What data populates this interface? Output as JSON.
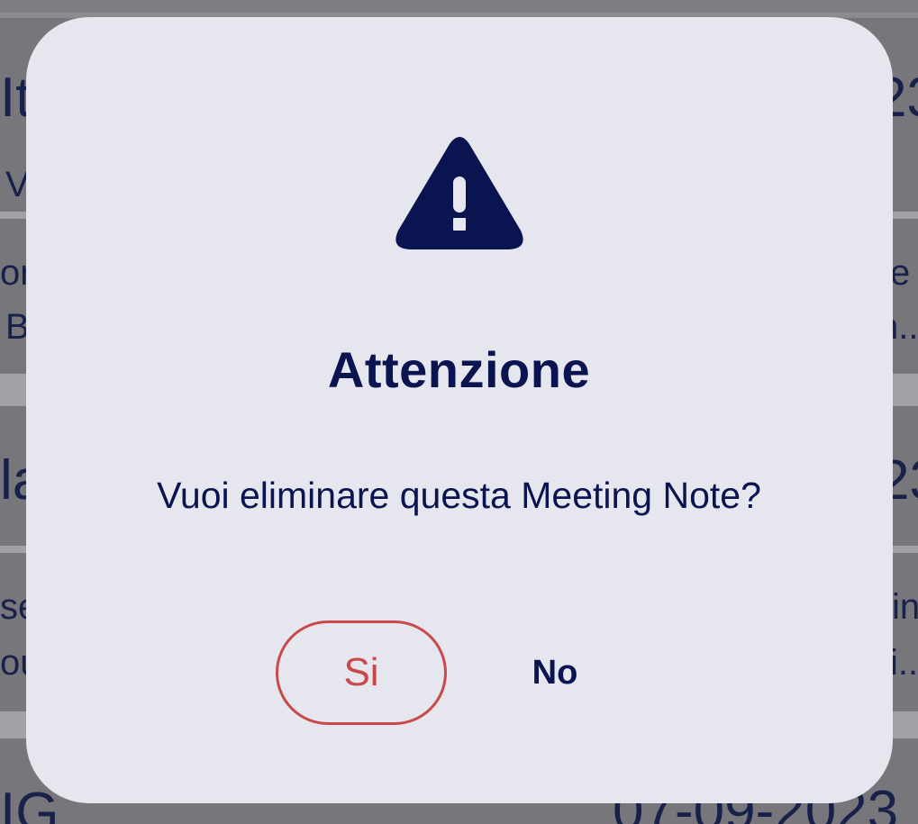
{
  "dialog": {
    "title": "Attenzione",
    "message": "Vuoi eliminare questa Meeting Note?",
    "confirm_label": "Si",
    "cancel_label": "No",
    "icon": "warning-triangle-icon"
  },
  "background_list": {
    "items": [
      {
        "title": "It",
        "date": "23",
        "line1": "V"
      },
      {
        "line1": "or",
        "line2": "B",
        "right1": "e",
        "right2": "n.."
      },
      {
        "title": "la",
        "date": "23"
      },
      {
        "line1": "se",
        "line2": "ou",
        "right1": "in",
        "right2": "i.."
      },
      {
        "title": "IG",
        "date": "07-09-2023"
      }
    ]
  },
  "colors": {
    "accent_text": "#0a1450",
    "danger": "#c9494b",
    "dialog_bg": "#e6e6ee"
  }
}
